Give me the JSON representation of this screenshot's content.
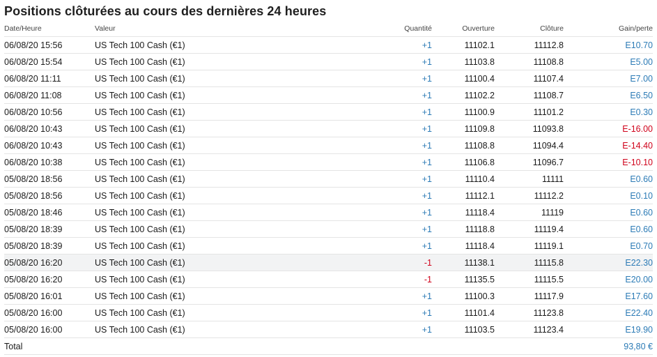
{
  "title": "Positions clôturées au cours des dernières 24 heures",
  "colors": {
    "positive": "#2c7bb6",
    "negative": "#d0021b"
  },
  "columns": {
    "date": "Date/Heure",
    "valeur": "Valeur",
    "quantite": "Quantité",
    "ouverture": "Ouverture",
    "cloture": "Clôture",
    "gain": "Gain/perte"
  },
  "rows": [
    {
      "date": "06/08/20 15:56",
      "valeur": "US Tech 100 Cash (€1)",
      "qty": "+1",
      "open": "11102.1",
      "close": "11112.8",
      "gain": "E10.70",
      "qty_sign": "pos",
      "gain_sign": "pos"
    },
    {
      "date": "06/08/20 15:54",
      "valeur": "US Tech 100 Cash (€1)",
      "qty": "+1",
      "open": "11103.8",
      "close": "11108.8",
      "gain": "E5.00",
      "qty_sign": "pos",
      "gain_sign": "pos"
    },
    {
      "date": "06/08/20 11:11",
      "valeur": "US Tech 100 Cash (€1)",
      "qty": "+1",
      "open": "11100.4",
      "close": "11107.4",
      "gain": "E7.00",
      "qty_sign": "pos",
      "gain_sign": "pos"
    },
    {
      "date": "06/08/20 11:08",
      "valeur": "US Tech 100 Cash (€1)",
      "qty": "+1",
      "open": "11102.2",
      "close": "11108.7",
      "gain": "E6.50",
      "qty_sign": "pos",
      "gain_sign": "pos"
    },
    {
      "date": "06/08/20 10:56",
      "valeur": "US Tech 100 Cash (€1)",
      "qty": "+1",
      "open": "11100.9",
      "close": "11101.2",
      "gain": "E0.30",
      "qty_sign": "pos",
      "gain_sign": "pos"
    },
    {
      "date": "06/08/20 10:43",
      "valeur": "US Tech 100 Cash (€1)",
      "qty": "+1",
      "open": "11109.8",
      "close": "11093.8",
      "gain": "E-16.00",
      "qty_sign": "pos",
      "gain_sign": "neg"
    },
    {
      "date": "06/08/20 10:43",
      "valeur": "US Tech 100 Cash (€1)",
      "qty": "+1",
      "open": "11108.8",
      "close": "11094.4",
      "gain": "E-14.40",
      "qty_sign": "pos",
      "gain_sign": "neg"
    },
    {
      "date": "06/08/20 10:38",
      "valeur": "US Tech 100 Cash (€1)",
      "qty": "+1",
      "open": "11106.8",
      "close": "11096.7",
      "gain": "E-10.10",
      "qty_sign": "pos",
      "gain_sign": "neg"
    },
    {
      "date": "05/08/20 18:56",
      "valeur": "US Tech 100 Cash (€1)",
      "qty": "+1",
      "open": "11110.4",
      "close": "11111",
      "gain": "E0.60",
      "qty_sign": "pos",
      "gain_sign": "pos"
    },
    {
      "date": "05/08/20 18:56",
      "valeur": "US Tech 100 Cash (€1)",
      "qty": "+1",
      "open": "11112.1",
      "close": "11112.2",
      "gain": "E0.10",
      "qty_sign": "pos",
      "gain_sign": "pos"
    },
    {
      "date": "05/08/20 18:46",
      "valeur": "US Tech 100 Cash (€1)",
      "qty": "+1",
      "open": "11118.4",
      "close": "11119",
      "gain": "E0.60",
      "qty_sign": "pos",
      "gain_sign": "pos"
    },
    {
      "date": "05/08/20 18:39",
      "valeur": "US Tech 100 Cash (€1)",
      "qty": "+1",
      "open": "11118.8",
      "close": "11119.4",
      "gain": "E0.60",
      "qty_sign": "pos",
      "gain_sign": "pos"
    },
    {
      "date": "05/08/20 18:39",
      "valeur": "US Tech 100 Cash (€1)",
      "qty": "+1",
      "open": "11118.4",
      "close": "11119.1",
      "gain": "E0.70",
      "qty_sign": "pos",
      "gain_sign": "pos"
    },
    {
      "date": "05/08/20 16:20",
      "valeur": "US Tech 100 Cash (€1)",
      "qty": "-1",
      "open": "11138.1",
      "close": "11115.8",
      "gain": "E22.30",
      "qty_sign": "neg",
      "gain_sign": "pos",
      "highlighted": true
    },
    {
      "date": "05/08/20 16:20",
      "valeur": "US Tech 100 Cash (€1)",
      "qty": "-1",
      "open": "11135.5",
      "close": "11115.5",
      "gain": "E20.00",
      "qty_sign": "neg",
      "gain_sign": "pos"
    },
    {
      "date": "05/08/20 16:01",
      "valeur": "US Tech 100 Cash (€1)",
      "qty": "+1",
      "open": "11100.3",
      "close": "11117.9",
      "gain": "E17.60",
      "qty_sign": "pos",
      "gain_sign": "pos"
    },
    {
      "date": "05/08/20 16:00",
      "valeur": "US Tech 100 Cash (€1)",
      "qty": "+1",
      "open": "11101.4",
      "close": "11123.8",
      "gain": "E22.40",
      "qty_sign": "pos",
      "gain_sign": "pos"
    },
    {
      "date": "05/08/20 16:00",
      "valeur": "US Tech 100 Cash (€1)",
      "qty": "+1",
      "open": "11103.5",
      "close": "11123.4",
      "gain": "E19.90",
      "qty_sign": "pos",
      "gain_sign": "pos"
    }
  ],
  "total": {
    "label": "Total",
    "value": "93,80 €"
  }
}
